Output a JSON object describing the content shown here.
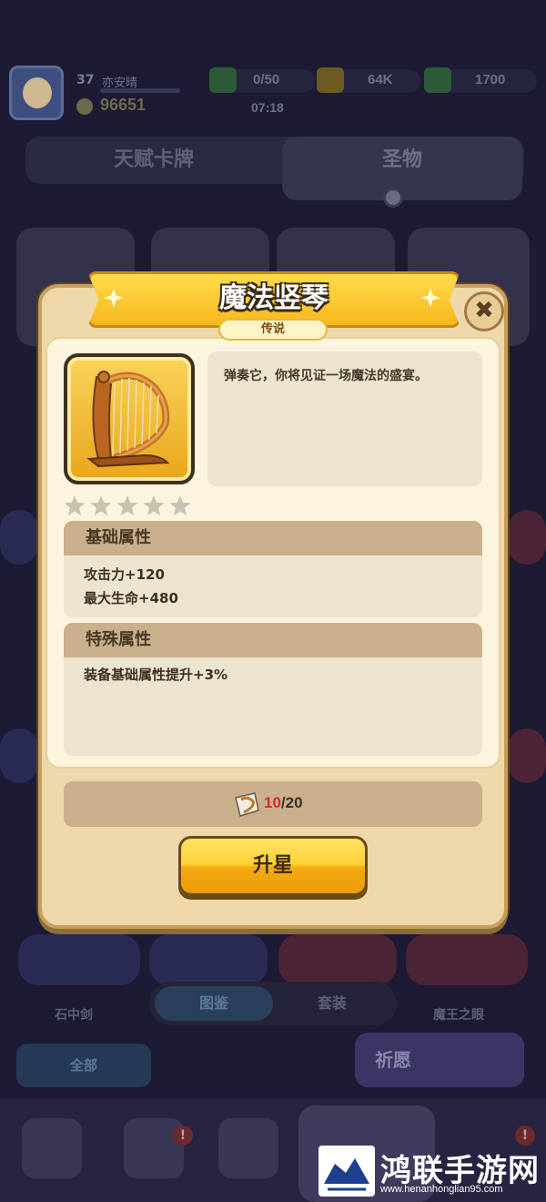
{
  "player": {
    "level": "37",
    "name": "亦安晴",
    "power": "96651"
  },
  "resources": [
    {
      "name": "energy",
      "value": "0/50",
      "color": "#2f8d45"
    },
    {
      "name": "gold",
      "value": "64K",
      "color": "#b8972a"
    },
    {
      "name": "gems",
      "value": "1700",
      "color": "#2f8d45"
    }
  ],
  "timer": "07:18",
  "tabs": [
    {
      "label": "天赋卡牌",
      "active": false
    },
    {
      "label": "圣物",
      "active": true
    }
  ],
  "background": {
    "item_label_left": "石中剑",
    "item_label_right": "魔王之眼",
    "segment_tabs": [
      "图鉴",
      "套装"
    ],
    "all_button": "全部",
    "pray_button": "祈愿",
    "badge_mark": "!"
  },
  "dialog": {
    "title": "魔法竖琴",
    "rarity": "传说",
    "close_label": "✖",
    "item_icon": "harp-icon",
    "stars_filled": 0,
    "stars_total": 5,
    "description": "弹奏它，你将见证一场魔法的盛宴。",
    "base_section": {
      "title": "基础属性",
      "stats": [
        "攻击力+120",
        "最大生命+480"
      ]
    },
    "special_section": {
      "title": "特殊属性",
      "stats": [
        "装备基础属性提升+3%"
      ]
    },
    "progress": {
      "current": "10",
      "separator_total": "/20",
      "icon": "harp-shard-icon"
    },
    "upgrade_button": "升星"
  },
  "watermark": {
    "name": "鸿联手游网",
    "url": "www.henanhonglian95.com"
  },
  "colors": {
    "dialog_bg": "#eed8a9",
    "ribbon_gold": "#f6b81e",
    "progress_current": "#e3262a"
  }
}
